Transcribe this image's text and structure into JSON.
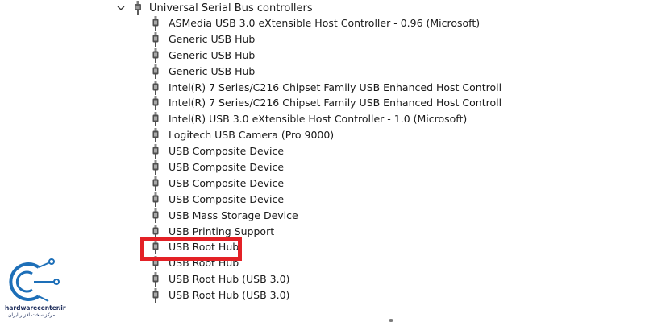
{
  "category": {
    "label": "Universal Serial Bus controllers",
    "expanded": true,
    "icon": "usb-controller-icon"
  },
  "devices": [
    {
      "label": "ASMedia USB 3.0 eXtensible Host Controller - 0.96 (Microsoft)",
      "icon": "usb-plug-icon"
    },
    {
      "label": "Generic USB Hub",
      "icon": "usb-plug-icon"
    },
    {
      "label": "Generic USB Hub",
      "icon": "usb-plug-icon"
    },
    {
      "label": "Generic USB Hub",
      "icon": "usb-plug-icon"
    },
    {
      "label": "Intel(R) 7 Series/C216 Chipset Family USB Enhanced Host Controll",
      "icon": "usb-plug-icon"
    },
    {
      "label": "Intel(R) 7 Series/C216 Chipset Family USB Enhanced Host Controll",
      "icon": "usb-plug-icon"
    },
    {
      "label": "Intel(R) USB 3.0 eXtensible Host Controller - 1.0 (Microsoft)",
      "icon": "usb-plug-icon"
    },
    {
      "label": "Logitech USB Camera (Pro 9000)",
      "icon": "usb-plug-icon"
    },
    {
      "label": "USB Composite Device",
      "icon": "usb-plug-icon"
    },
    {
      "label": "USB Composite Device",
      "icon": "usb-plug-icon"
    },
    {
      "label": "USB Composite Device",
      "icon": "usb-plug-icon"
    },
    {
      "label": "USB Composite Device",
      "icon": "usb-plug-icon"
    },
    {
      "label": "USB Mass Storage Device",
      "icon": "usb-plug-icon"
    },
    {
      "label": "USB Printing Support",
      "icon": "usb-plug-icon"
    },
    {
      "label": "USB Root Hub",
      "icon": "usb-plug-icon",
      "highlighted": true
    },
    {
      "label": "USB Root Hub",
      "icon": "usb-plug-icon"
    },
    {
      "label": "USB Root Hub (USB 3.0)",
      "icon": "usb-plug-icon"
    },
    {
      "label": "USB Root Hub (USB 3.0)",
      "icon": "usb-plug-icon"
    }
  ],
  "highlight_color": "#e32126",
  "watermark": {
    "name": "hardwarecenter.ir",
    "subtitle": "مرکز سخت افزار ایران",
    "logo_color": "#1d6fb8",
    "icon": "circuit-c-logo-icon"
  }
}
